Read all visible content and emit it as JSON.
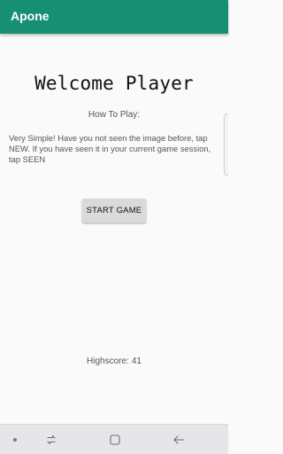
{
  "app_bar": {
    "title": "Apone",
    "color": "#168f73"
  },
  "main": {
    "welcome": "Welcome Player",
    "how_to_title": "How To Play:",
    "instructions": "Very Simple! Have you not seen the image before, tap NEW. If you have seen it in your current game session, tap SEEN",
    "start_button": "START GAME",
    "highscore_label": "Highscore:",
    "highscore_value": "41"
  },
  "nav_bar": {
    "icons": [
      "dot-icon",
      "recent-apps-icon",
      "home-icon",
      "back-icon"
    ]
  }
}
